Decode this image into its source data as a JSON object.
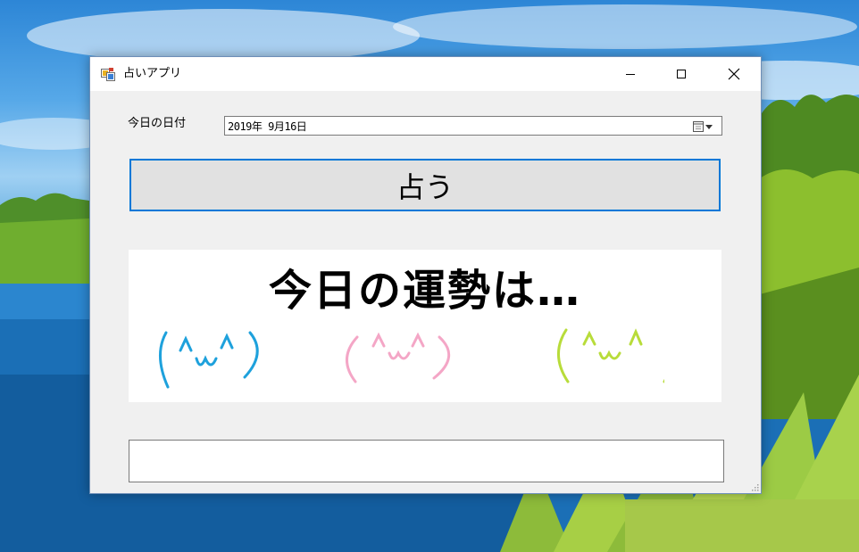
{
  "window": {
    "title": "占いアプリ",
    "icons": {
      "app": "app-icon",
      "minimize": "minimize-icon",
      "maximize": "maximize-icon",
      "close": "close-icon"
    }
  },
  "form": {
    "date_label": "今日の日付",
    "date_value": "2019年  9月16日",
    "date_picker_icon": "calendar-dropdown-icon",
    "fortune_button_label": "占う",
    "result_text": ""
  },
  "picture": {
    "headline": "今日の運勢は…",
    "faces": [
      {
        "name": "face-blue",
        "text": "(^ω^)",
        "color": "#1ea1dc"
      },
      {
        "name": "face-pink",
        "text": "(^ω^)",
        "color": "#f4a6c6"
      },
      {
        "name": "face-green",
        "text": "(^ω^)",
        "color": "#b8dc3a"
      }
    ]
  },
  "colors": {
    "accent": "#0078d7",
    "window_bg": "#f0f0f0",
    "button_bg": "#e1e1e1"
  }
}
